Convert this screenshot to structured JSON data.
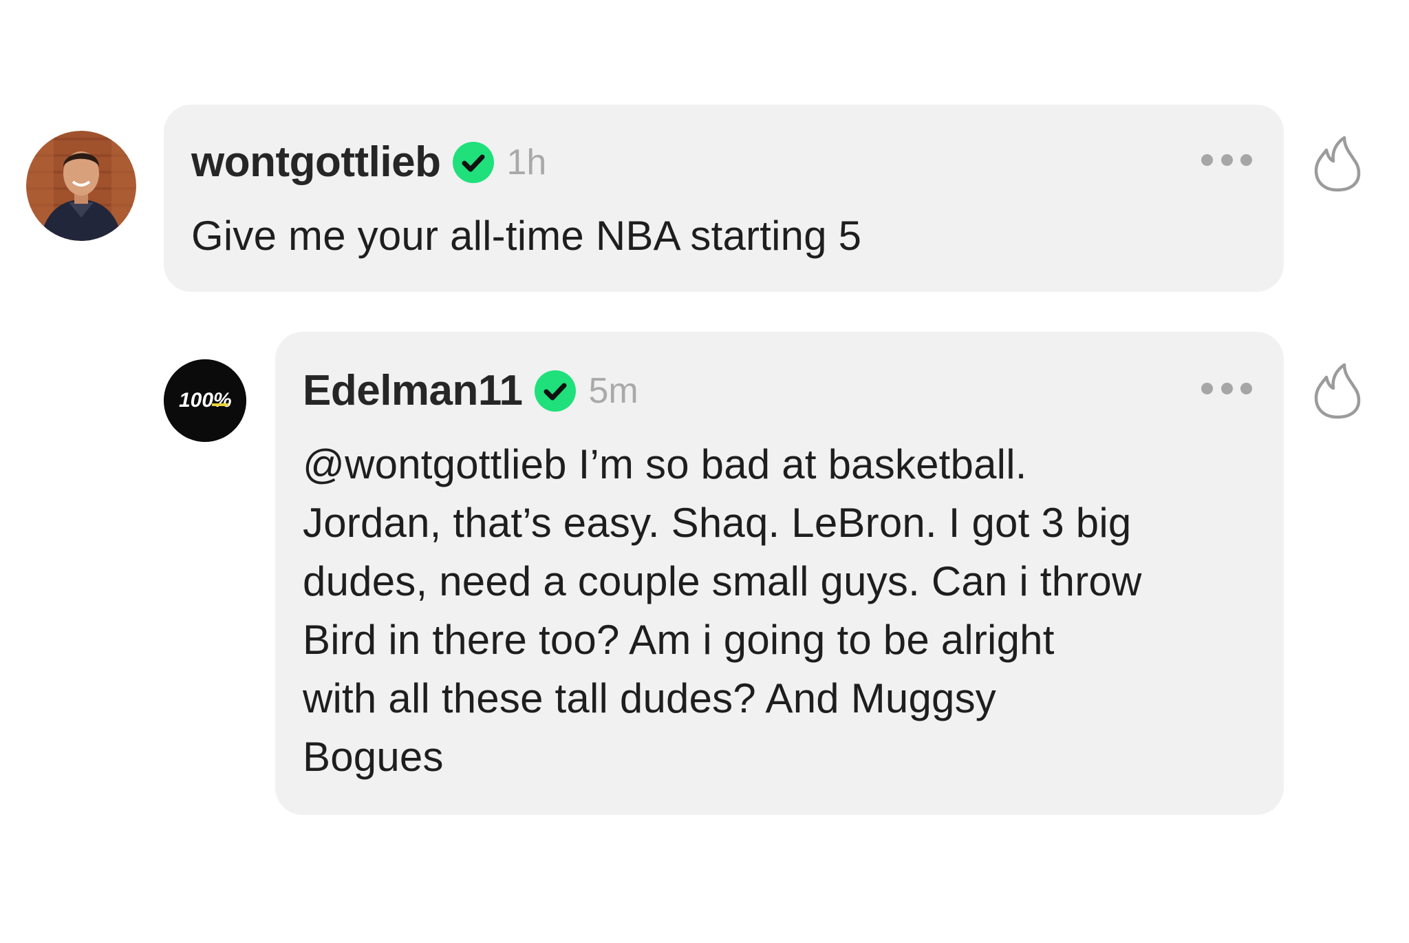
{
  "comments": [
    {
      "username": "wontgottlieb",
      "verified": true,
      "timestamp": "1h",
      "text": "Give me your all-time NBA starting 5",
      "avatar_icon": "user-photo-avatar"
    },
    {
      "username": "Edelman11",
      "verified": true,
      "timestamp": "5m",
      "text_lines": [
        "@wontgottlieb I’m so bad at basketball.",
        "Jordan, that’s easy. Shaq. LeBron. I got 3 big",
        "dudes, need a couple small guys. Can i throw",
        "Bird in there too? Am i going to be alright",
        "with all these tall dudes? And Muggsy",
        "Bogues"
      ],
      "avatar_logo_text": "100%"
    }
  ],
  "icons": {
    "more": "more-horizontal-icon",
    "fire": "fire-icon",
    "verified": "verified-badge-icon"
  },
  "colors": {
    "bubble": "#f1f1f1",
    "verified": "#1fe07a",
    "muted": "#a9a9a9"
  }
}
